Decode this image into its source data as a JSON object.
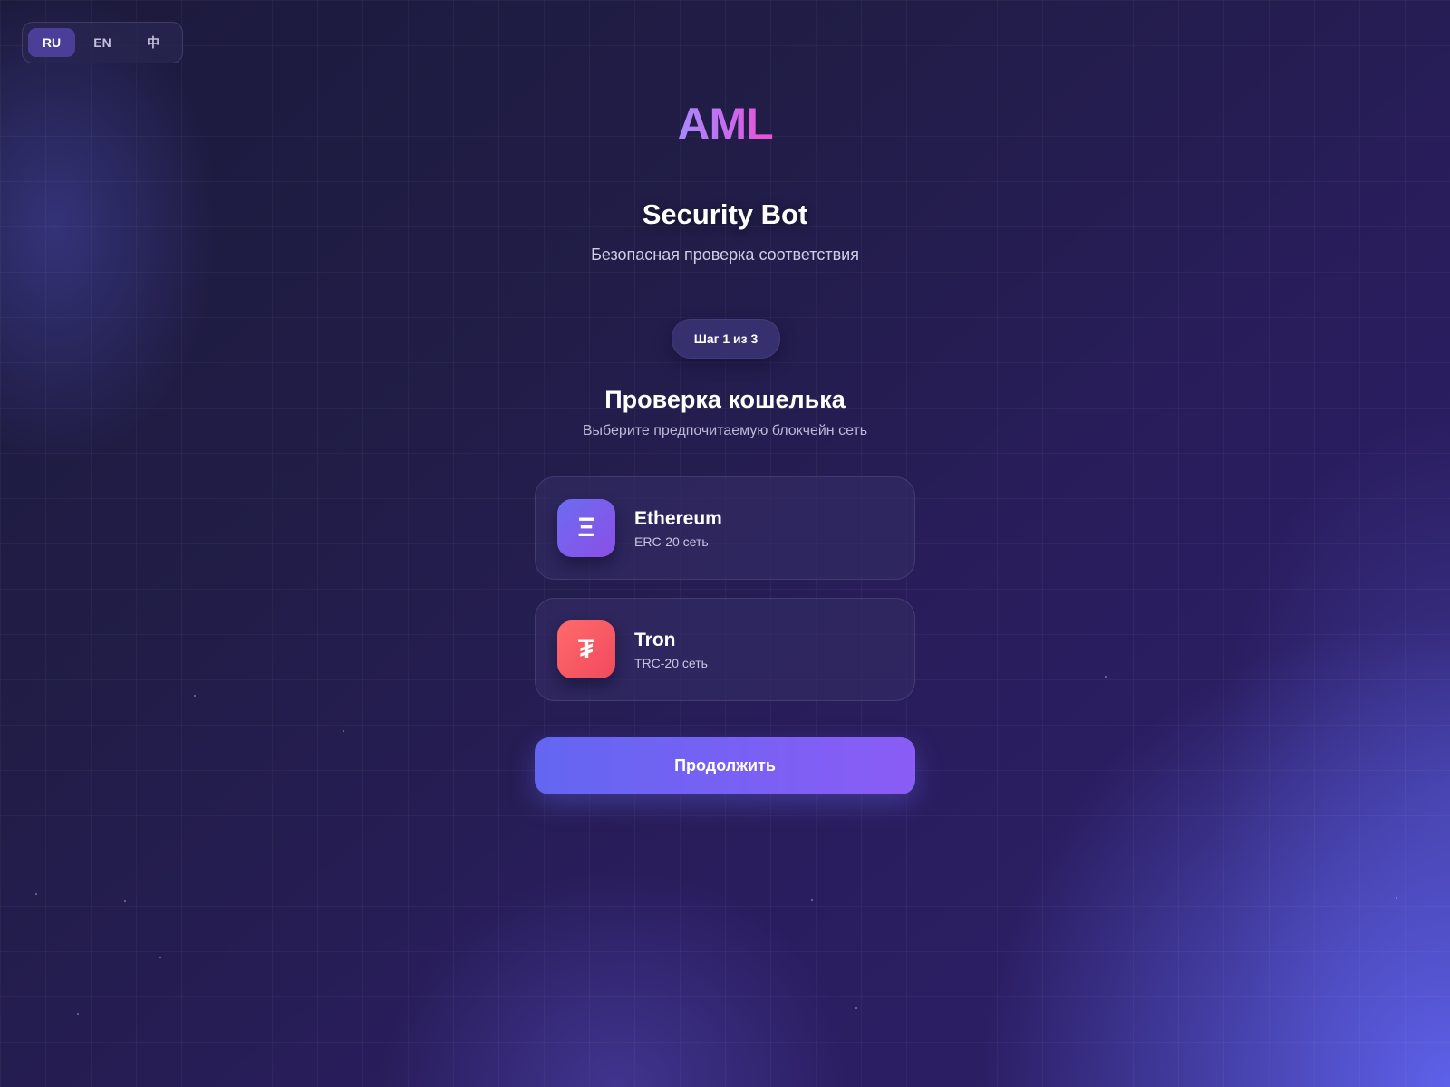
{
  "language_switcher": {
    "options": [
      "RU",
      "EN",
      "中"
    ],
    "selected": "RU"
  },
  "header": {
    "logo_text": "AML",
    "app_title": "Security Bot",
    "app_subtitle": "Безопасная проверка соответствия"
  },
  "step": {
    "label": "Шаг 1 из 3",
    "current": 1,
    "total": 3
  },
  "section": {
    "title": "Проверка кошелька",
    "subtitle": "Выберите предпочитаемую блокчейн сеть"
  },
  "networks": [
    {
      "name": "Ethereum",
      "standard": "ERC-20 сеть",
      "icon_glyph": "Ξ",
      "icon": "ethereum-icon",
      "color_from": "#6d6cf0",
      "color_to": "#8b4fe6"
    },
    {
      "name": "Tron",
      "standard": "TRC-20 сеть",
      "icon_glyph": "₮",
      "icon": "tether-icon",
      "color_from": "#ff6b6b",
      "color_to": "#f04a5e"
    }
  ],
  "actions": {
    "continue_label": "Продолжить"
  },
  "colors": {
    "accent": "#6366f1",
    "accent_secondary": "#8b5cf6",
    "logo_gradient": [
      "#a78bfa",
      "#ee4fd0"
    ],
    "background": "#211d48"
  }
}
